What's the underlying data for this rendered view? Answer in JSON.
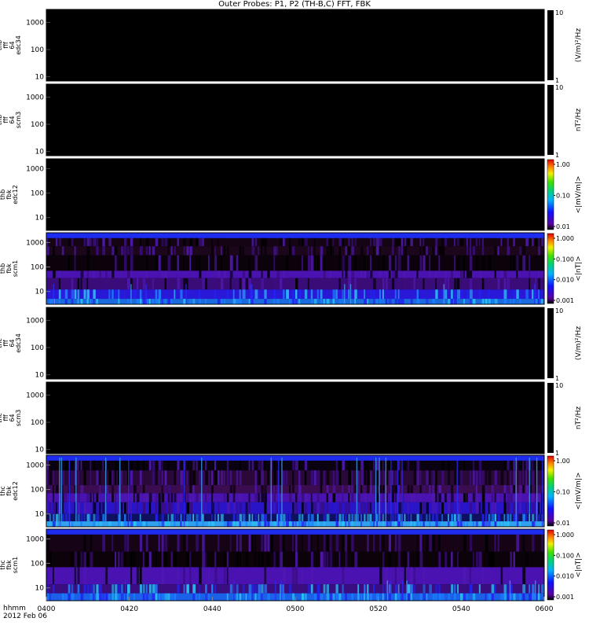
{
  "title": "Outer Probes: P1, P2 (TH-B,C) FFT, FBK",
  "x_axis": {
    "label": "hhmm",
    "date": "2012 Feb 06",
    "ticks": [
      "0400",
      "0420",
      "0440",
      "0500",
      "0520",
      "0540",
      "0600"
    ]
  },
  "chart_data": [
    {
      "type": "heatmap",
      "probe": "thb",
      "ylabel": [
        "thb",
        "fff",
        "64",
        "edc34"
      ],
      "yticks": [
        "1000",
        "100",
        "10"
      ],
      "ylog": true,
      "ylim": [
        7,
        3000
      ],
      "zlabel": "(V/m)²/Hz",
      "zticks": [
        "10",
        "1"
      ],
      "zscale": "mono",
      "has_data": false
    },
    {
      "type": "heatmap",
      "probe": "thb",
      "ylabel": [
        "thb",
        "fff",
        "64",
        "scm3"
      ],
      "yticks": [
        "1000",
        "100",
        "10"
      ],
      "ylog": true,
      "ylim": [
        7,
        3000
      ],
      "zlabel": "nT²/Hz",
      "zticks": [
        "10",
        "1"
      ],
      "zscale": "mono",
      "has_data": false
    },
    {
      "type": "heatmap",
      "probe": "thb",
      "ylabel": [
        "thb",
        "fbk",
        "edc12"
      ],
      "yticks": [
        "1000",
        "100",
        "10"
      ],
      "ylog": true,
      "ylim": [
        3,
        2500
      ],
      "zlabel": "<|mV/m|>",
      "zticks": [
        "1.00",
        "0.10",
        "0.01"
      ],
      "zscale": "rainbow",
      "has_data": false
    },
    {
      "type": "heatmap",
      "probe": "thb",
      "ylabel": [
        "thb",
        "fbk",
        "scm1"
      ],
      "yticks": [
        "1000",
        "100",
        "10"
      ],
      "ylog": true,
      "ylim": [
        3,
        2500
      ],
      "zlabel": "<|nT|>",
      "zticks": [
        "1.000",
        "0.100",
        "0.010",
        "0.001"
      ],
      "zscale": "rainbow",
      "has_data": true,
      "variant": "b"
    },
    {
      "type": "heatmap",
      "probe": "thc",
      "ylabel": [
        "thc",
        "fff",
        "64",
        "edc34"
      ],
      "yticks": [
        "1000",
        "100",
        "10"
      ],
      "ylog": true,
      "ylim": [
        7,
        3000
      ],
      "zlabel": "(V/m)²/Hz",
      "zticks": [
        "10",
        "1"
      ],
      "zscale": "mono",
      "has_data": false
    },
    {
      "type": "heatmap",
      "probe": "thc",
      "ylabel": [
        "thc",
        "fff",
        "64",
        "scm3"
      ],
      "yticks": [
        "1000",
        "100",
        "10"
      ],
      "ylog": true,
      "ylim": [
        7,
        3000
      ],
      "zlabel": "nT²/Hz",
      "zticks": [
        "10",
        "1"
      ],
      "zscale": "mono",
      "has_data": false
    },
    {
      "type": "heatmap",
      "probe": "thc",
      "ylabel": [
        "thc",
        "fbk",
        "edc12"
      ],
      "yticks": [
        "1000",
        "100",
        "10"
      ],
      "ylog": true,
      "ylim": [
        3,
        2500
      ],
      "zlabel": "<|mV/m|>",
      "zticks": [
        "1.00",
        "0.10",
        "0.01"
      ],
      "zscale": "rainbow",
      "has_data": true,
      "variant": "c-edc"
    },
    {
      "type": "heatmap",
      "probe": "thc",
      "ylabel": [
        "thc",
        "fbk",
        "scm1"
      ],
      "yticks": [
        "1000",
        "100",
        "10"
      ],
      "ylog": true,
      "ylim": [
        3,
        2500
      ],
      "zlabel": "<|nT|>",
      "zticks": [
        "1.000",
        "0.100",
        "0.010",
        "0.001"
      ],
      "zscale": "rainbow",
      "has_data": true,
      "variant": "c-scm"
    }
  ],
  "colors": {
    "background": "#000000",
    "top_band": "#1e2cf0",
    "low_band": "#4a12b0",
    "mid_band": "#3a0c78",
    "dark_band": "#2a0838",
    "cyan": "#2bc3f5"
  }
}
